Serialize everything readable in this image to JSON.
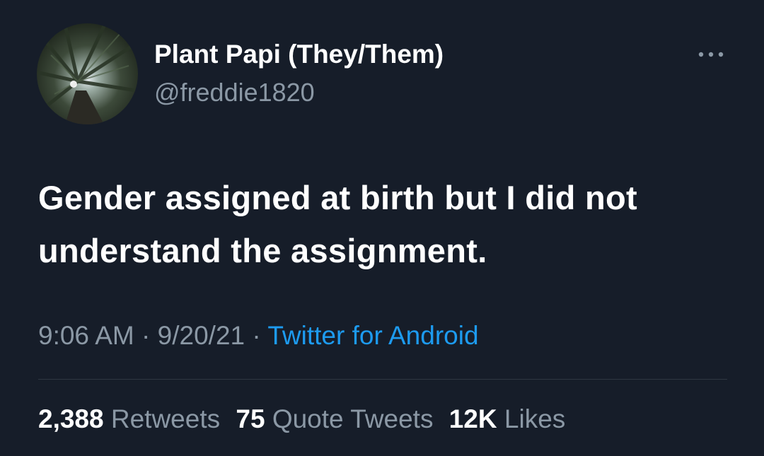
{
  "user": {
    "display_name": "Plant Papi (They/Them)",
    "handle": "@freddie1820"
  },
  "tweet": {
    "text": "Gender assigned at birth but I did not understand the assignment."
  },
  "meta": {
    "time": "9:06 AM",
    "dot": "·",
    "date": "9/20/21",
    "source": "Twitter for Android"
  },
  "stats": {
    "retweets_count": "2,388",
    "retweets_label": "Retweets",
    "quotes_count": "75",
    "quotes_label": "Quote Tweets",
    "likes_count": "12K",
    "likes_label": "Likes"
  },
  "icons": {
    "more": "more-options-icon",
    "avatar": "avatar-tree-canopy"
  },
  "colors": {
    "background": "#161d29",
    "primary_text": "#ffffff",
    "secondary_text": "#8b98a5",
    "link": "#1d9bf0",
    "divider": "#2f3742"
  }
}
